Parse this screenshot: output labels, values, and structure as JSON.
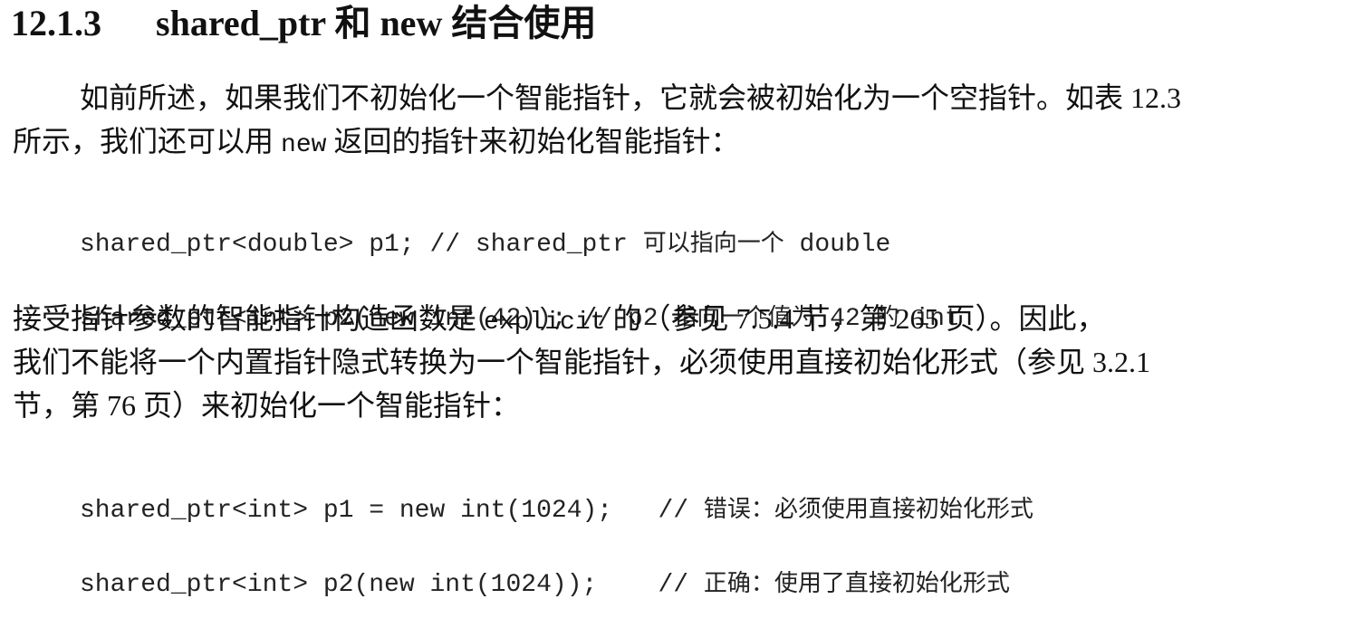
{
  "section": {
    "number": "12.1.3",
    "heading": "shared_ptr 和 new 结合使用"
  },
  "paragraph1": {
    "line1": "如前所述，如果我们不初始化一个智能指针，它就会被初始化为一个空指针。如表 12.3",
    "line2_pre": "所示，我们还可以用 ",
    "line2_code": "new",
    "line2_post": " 返回的指针来初始化智能指针："
  },
  "code_block1": {
    "line1_code": "shared_ptr<double> p1; // shared_ptr ",
    "line1_comment": "可以指向一个",
    "line1_tail": " double",
    "line2_code": "shared_ptr<int> p2(new int(42)); // p2 ",
    "line2_comment": "指向一个值为",
    "line2_mid": " 42 ",
    "line2_comment2": "的",
    "line2_tail": " int"
  },
  "paragraph2": {
    "line1_pre": "接受指针参数的智能指针构造函数是 ",
    "line1_code": "explicit",
    "line1_post": " 的（参见 7.5.4 节，第 265 页）。因此，",
    "line2": "我们不能将一个内置指针隐式转换为一个智能指针，必须使用直接初始化形式（参见 3.2.1",
    "line3": "节，第 76 页）来初始化一个智能指针："
  },
  "code_block2": {
    "line1_code": "shared_ptr<int> p1 = new int(1024);   // ",
    "line1_comment": "错误：必须使用直接初始化形式",
    "line2_code": "shared_ptr<int> p2(new int(1024));    // ",
    "line2_comment": "正确：使用了直接初始化形式"
  }
}
